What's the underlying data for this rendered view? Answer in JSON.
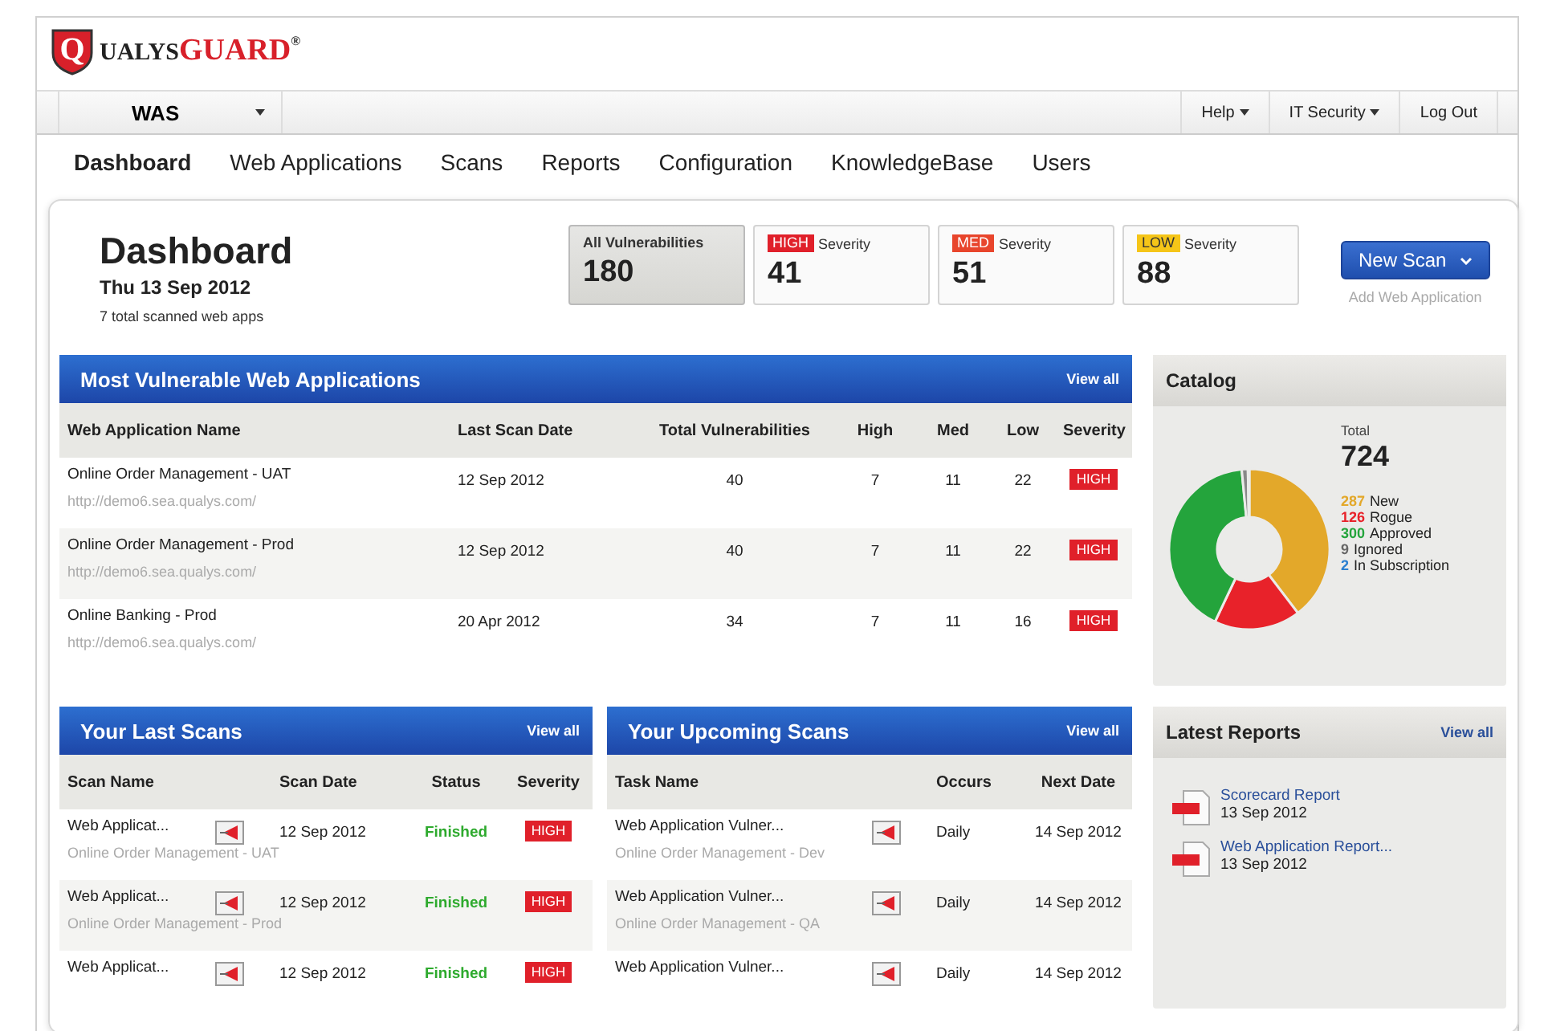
{
  "logo": {
    "shield_letter": "Q",
    "name": "UALYS",
    "name_accent": "GUARD",
    "registered": "®"
  },
  "top_bar": {
    "module": "WAS",
    "menus": [
      {
        "label": "Help",
        "dropdown": true
      },
      {
        "label": "IT Security",
        "dropdown": true
      },
      {
        "label": "Log Out",
        "dropdown": false
      }
    ]
  },
  "nav_tabs": [
    {
      "label": "Dashboard",
      "selected": true
    },
    {
      "label": "Web Applications",
      "selected": false
    },
    {
      "label": "Scans",
      "selected": false
    },
    {
      "label": "Reports",
      "selected": false
    },
    {
      "label": "Configuration",
      "selected": false
    },
    {
      "label": "KnowledgeBase",
      "selected": false
    },
    {
      "label": "Users",
      "selected": false
    }
  ],
  "header": {
    "title": "Dashboard",
    "date": "Thu 13 Sep 2012",
    "subtitle": "7 total scanned web apps"
  },
  "summary_cards": [
    {
      "label": "All Vulnerabilities",
      "value": "180",
      "selected": true
    },
    {
      "badge": "HIGH",
      "color": "#e0202a",
      "label": "Severity",
      "value": "41",
      "selected": false
    },
    {
      "badge": "MED",
      "color": "#e8452c",
      "label": "Severity",
      "value": "51",
      "selected": false
    },
    {
      "badge": "LOW",
      "color": "#f5c518",
      "label": "Severity",
      "value": "88",
      "selected": false
    }
  ],
  "new_scan_button": "New Scan",
  "add_link": "Add Web Application",
  "vulnerable_apps": {
    "title": "Most Vulnerable Web Applications",
    "view_all": "View all",
    "columns": [
      "Web Application Name",
      "Last Scan Date",
      "Total Vulnerabilities",
      "High",
      "Med",
      "Low",
      "Severity"
    ],
    "rows": [
      {
        "name": "Online Order Management - UAT",
        "url": "http://demo6.sea.qualys.com/",
        "last_scan": "12 Sep 2012",
        "total": "40",
        "high": "7",
        "med": "11",
        "low": "22",
        "severity": "HIGH"
      },
      {
        "name": "Online Order Management - Prod",
        "url": "http://demo6.sea.qualys.com/",
        "last_scan": "12 Sep 2012",
        "total": "40",
        "high": "7",
        "med": "11",
        "low": "22",
        "severity": "HIGH"
      },
      {
        "name": "Online Banking - Prod",
        "url": "http://demo6.sea.qualys.com/",
        "last_scan": "20 Apr 2012",
        "total": "34",
        "high": "7",
        "med": "11",
        "low": "16",
        "severity": "HIGH"
      }
    ]
  },
  "catalog": {
    "total_label": "Total",
    "total": "724",
    "chart_data": {
      "type": "donut",
      "title": "Catalog",
      "categories": [
        "New",
        "Rogue",
        "Approved",
        "Ignored",
        "In Subscription"
      ],
      "values": [
        39.64,
        17.4,
        41.44,
        1.24,
        0.28
      ],
      "colors": [
        "#e3a82a",
        "#e8222a",
        "#24a43c",
        "#888888",
        "#2a7fd0"
      ]
    },
    "legend": [
      {
        "count": "287",
        "color": "#e3a82a"
      },
      {
        "count": "126",
        "color": "#e8222a"
      },
      {
        "count": "300",
        "color": "#24a43c"
      },
      {
        "count": "9",
        "color": "#666666"
      },
      {
        "count": "2",
        "color": "#2a7fd0"
      }
    ]
  },
  "last_scans": {
    "title": "Your Last Scans",
    "view_all": "View all",
    "columns": [
      "Scan Name",
      "Scan Date",
      "Status",
      "Severity"
    ],
    "rows": [
      {
        "name": "Web Applicat...",
        "target": "Online Order Management - UAT",
        "date": "12 Sep 2012",
        "status": "Finished",
        "severity": "HIGH"
      },
      {
        "name": "Web Applicat...",
        "target": "Online Order Management - Prod",
        "date": "12 Sep 2012",
        "status": "Finished",
        "severity": "HIGH"
      },
      {
        "name": "Web Applicat...",
        "date": "12 Sep 2012",
        "status": "Finished",
        "severity": "HIGH"
      }
    ]
  },
  "upcoming_scans": {
    "title": "Your Upcoming Scans",
    "view_all": "View all",
    "columns": [
      "Task Name",
      "Occurs",
      "Next Date"
    ],
    "rows": [
      {
        "name": "Web Application Vulner...",
        "target": "Online Order Management - Dev",
        "occurs": "Daily",
        "next_date": "14 Sep 2012"
      },
      {
        "name": "Web Application Vulner...",
        "target": "Online Order Management - QA",
        "occurs": "Daily",
        "next_date": "14 Sep 2012"
      },
      {
        "name": "Web Application Vulner...",
        "occurs": "Daily",
        "next_date": "14 Sep 2012"
      }
    ]
  },
  "latest_reports": {
    "title": "Latest Reports",
    "view_all": "View all",
    "items": [
      {
        "title": "Scorecard Report",
        "date": "13 Sep 2012"
      },
      {
        "title": "Web Application Report...",
        "date": "13 Sep 2012"
      }
    ]
  }
}
